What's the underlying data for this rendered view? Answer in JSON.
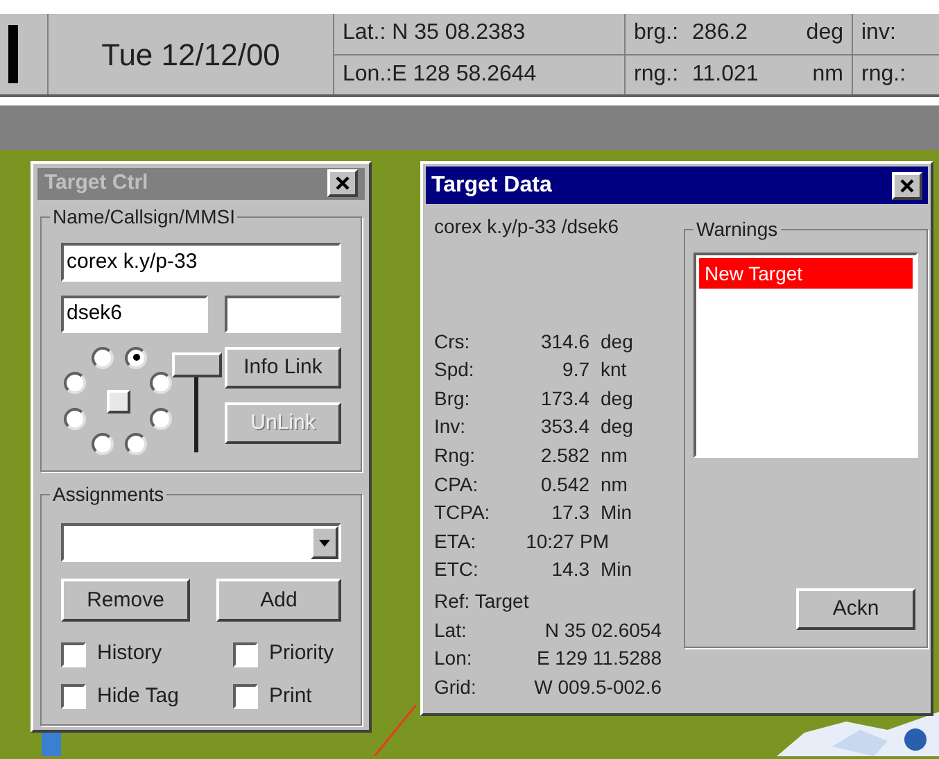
{
  "status_bar": {
    "date": "Tue 12/12/00",
    "lat": "Lat.: N 35 08.2383",
    "lon": "Lon.:E 128 58.2644",
    "brg": {
      "label": "brg.:",
      "value": "286.2",
      "unit": "deg"
    },
    "rng": {
      "label": "rng.:",
      "value": "11.021",
      "unit": "nm"
    },
    "inv": "inv:",
    "rng2": "rng.:"
  },
  "target_ctrl": {
    "title": "Target Ctrl",
    "active": false,
    "name_group": {
      "title": "Name/Callsign/MMSI",
      "name": "corex k.y/p-33",
      "callsign": "dsek6"
    },
    "positions": [
      {
        "selected": false
      },
      {
        "selected": true
      },
      {
        "selected": false
      },
      {
        "selected": false
      },
      {
        "selected": false
      },
      {
        "selected": false
      },
      {
        "selected": false
      },
      {
        "selected": false
      }
    ],
    "buttons": [
      {
        "label": "Info Link",
        "disabled": false
      },
      {
        "label": "UnLink",
        "disabled": true
      }
    ],
    "assignments": {
      "title": "Assignments",
      "remove": "Remove",
      "add": "Add",
      "options": [
        {
          "label": "History",
          "checked": false
        },
        {
          "label": "Priority",
          "checked": false
        },
        {
          "label": "Hide Tag",
          "checked": false
        },
        {
          "label": "Print",
          "checked": false
        }
      ]
    }
  },
  "target_data": {
    "title": "Target Data",
    "active": true,
    "target": "corex k.y/p-33 /dsek6",
    "rows": [
      {
        "label": "Crs:",
        "value": "314.6",
        "unit": "deg"
      },
      {
        "label": "Spd:",
        "value": "9.7",
        "unit": "knt"
      },
      {
        "label": "Brg:",
        "value": "173.4",
        "unit": "deg"
      },
      {
        "label": "Inv:",
        "value": "353.4",
        "unit": "deg"
      },
      {
        "label": "Rng:",
        "value": "2.582",
        "unit": "nm"
      },
      {
        "label": "CPA:",
        "value": "0.542",
        "unit": "nm"
      },
      {
        "label": "TCPA:",
        "value": "17.3",
        "unit": "Min"
      },
      {
        "label": "ETA:",
        "value": "10:27 PM"
      },
      {
        "label": "ETC:",
        "value": "14.3",
        "unit": "Min"
      }
    ],
    "ref": "Ref: Target",
    "ref_rows": [
      {
        "label": "Lat:",
        "value": "N 35 02.6054"
      },
      {
        "label": "Lon:",
        "value": "E 129 11.5288"
      },
      {
        "label": "Grid:",
        "value": "W 009.5-002.6"
      }
    ],
    "warnings": {
      "title": "Warnings",
      "items": [
        {
          "text": "New Target",
          "selected": true
        }
      ],
      "ackn": "Ackn"
    }
  }
}
